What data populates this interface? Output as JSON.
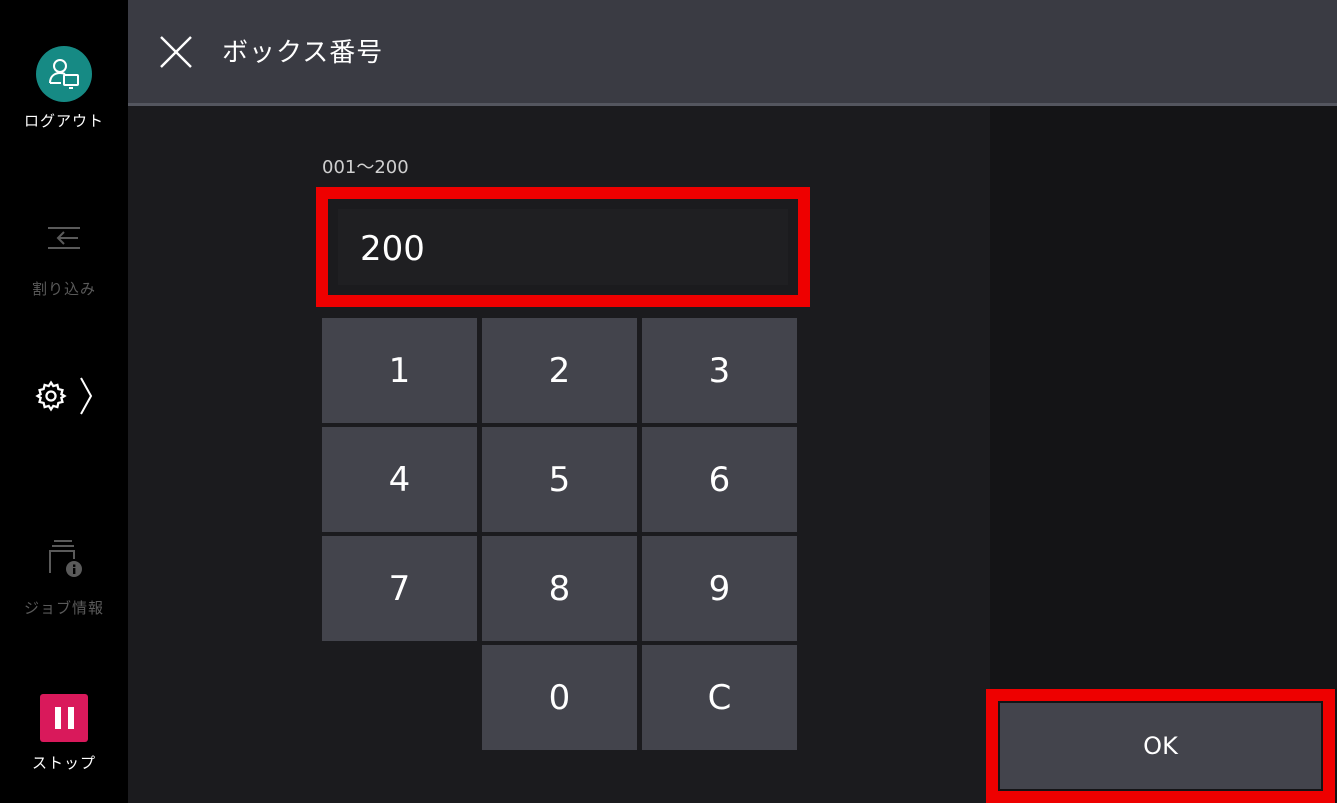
{
  "sidebar": {
    "logout_label": "ログアウト",
    "interrupt_label": "割り込み",
    "job_info_label": "ジョブ情報",
    "stop_label": "ストップ"
  },
  "header": {
    "title": "ボックス番号"
  },
  "input": {
    "range_label": "001〜200",
    "value": "200"
  },
  "keypad": {
    "k1": "1",
    "k2": "2",
    "k3": "3",
    "k4": "4",
    "k5": "5",
    "k6": "6",
    "k7": "7",
    "k8": "8",
    "k9": "9",
    "k0": "0",
    "kc": "C"
  },
  "ok_label": "OK",
  "colors": {
    "accent_red": "#ee0000",
    "avatar": "#168a84",
    "stop": "#d9195b"
  },
  "icons": [
    "user-monitor-icon",
    "interrupt-icon",
    "gear-icon",
    "chevron-right-icon",
    "job-info-icon",
    "pause-icon",
    "close-icon"
  ]
}
